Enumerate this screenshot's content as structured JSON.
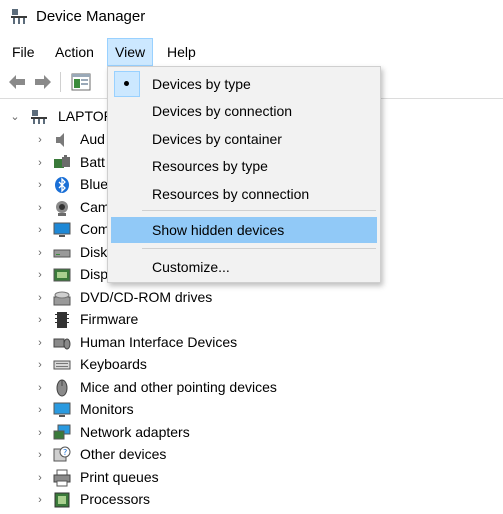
{
  "window": {
    "title": "Device Manager",
    "icon": "device-manager-icon"
  },
  "menubar": {
    "items": [
      {
        "label": "File"
      },
      {
        "label": "Action"
      },
      {
        "label": "View"
      },
      {
        "label": "Help"
      }
    ]
  },
  "toolbar": {
    "buttons": [
      "back-arrow-icon",
      "forward-arrow-icon",
      "properties-icon"
    ]
  },
  "tree": {
    "root_label": "LAPTOP-",
    "items": [
      {
        "label": "Aud",
        "icon": "audio-speaker-icon"
      },
      {
        "label": "Batt",
        "icon": "battery-icon"
      },
      {
        "label": "Blue",
        "icon": "bluetooth-icon"
      },
      {
        "label": "Cam",
        "icon": "camera-icon"
      },
      {
        "label": "Com",
        "icon": "computer-icon"
      },
      {
        "label": "Disk",
        "icon": "disk-drive-icon"
      },
      {
        "label": "Disp",
        "icon": "display-adapter-icon"
      },
      {
        "label": "DVD/CD-ROM drives",
        "icon": "dvd-drive-icon"
      },
      {
        "label": "Firmware",
        "icon": "firmware-icon"
      },
      {
        "label": "Human Interface Devices",
        "icon": "hid-icon"
      },
      {
        "label": "Keyboards",
        "icon": "keyboard-icon"
      },
      {
        "label": "Mice and other pointing devices",
        "icon": "mouse-icon"
      },
      {
        "label": "Monitors",
        "icon": "monitor-icon"
      },
      {
        "label": "Network adapters",
        "icon": "network-adapter-icon"
      },
      {
        "label": "Other devices",
        "icon": "unknown-device-icon"
      },
      {
        "label": "Print queues",
        "icon": "printer-icon"
      },
      {
        "label": "Processors",
        "icon": "processor-icon"
      }
    ]
  },
  "view_menu": {
    "items": [
      {
        "label": "Devices by type",
        "checked": true
      },
      {
        "label": "Devices by connection"
      },
      {
        "label": "Devices by container"
      },
      {
        "label": "Resources by type"
      },
      {
        "label": "Resources by connection"
      },
      {
        "label": "Show hidden devices",
        "highlighted": true
      },
      {
        "label": "Customize..."
      }
    ]
  },
  "colors": {
    "highlight": "#91c9f7",
    "menu_active": "#cce8ff",
    "menu_bg": "#f2f2f2"
  }
}
